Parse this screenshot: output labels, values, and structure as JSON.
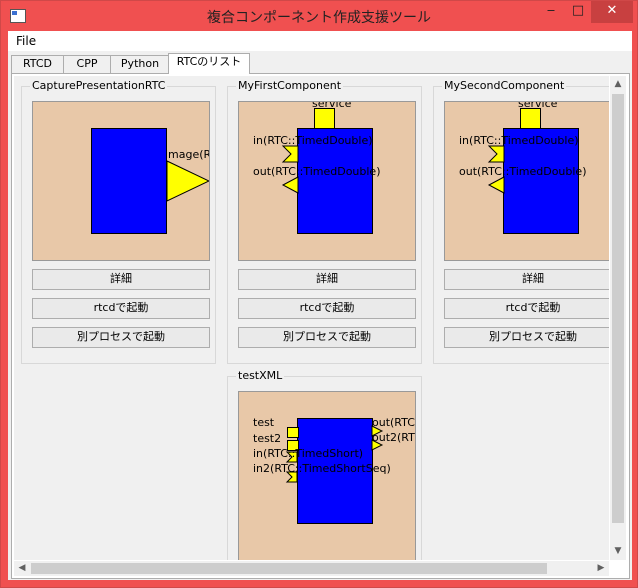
{
  "window": {
    "title": "複合コンポーネント作成支援ツール",
    "min": "‒",
    "max": "□",
    "close": "✕"
  },
  "menu": {
    "file": "File"
  },
  "tabs": [
    {
      "label": "RTCD"
    },
    {
      "label": "CPP"
    },
    {
      "label": "Python"
    },
    {
      "label": "RTCのリスト"
    }
  ],
  "buttons": {
    "details": "詳細",
    "rtcd_launch": "rtcdで起動",
    "separate_launch": "別プロセスで起動"
  },
  "components": [
    {
      "name": "CapturePresentationRTC",
      "ports": {
        "image": "image(R"
      }
    },
    {
      "name": "MyFirstComponent",
      "ports": {
        "service": "service",
        "in": "in(RTC::TimedDouble)",
        "out": "out(RTC::TimedDouble)"
      }
    },
    {
      "name": "MySecondComponent",
      "ports": {
        "service": "service",
        "in": "in(RTC::TimedDouble)",
        "out": "out(RTC::TimedDouble)"
      }
    },
    {
      "name": "testXML",
      "ports": {
        "test": "test",
        "test2": "test2",
        "in": "in(RTC::TimedShort)",
        "in2": "in2(RTC::TimedShortSeq)",
        "out": "out(RTC",
        "out2": "out2(RT"
      }
    }
  ],
  "colors": {
    "component": "#0000ff",
    "port": "#ffff00",
    "canvas": "#e8c8a8",
    "frame": "#f05050"
  }
}
